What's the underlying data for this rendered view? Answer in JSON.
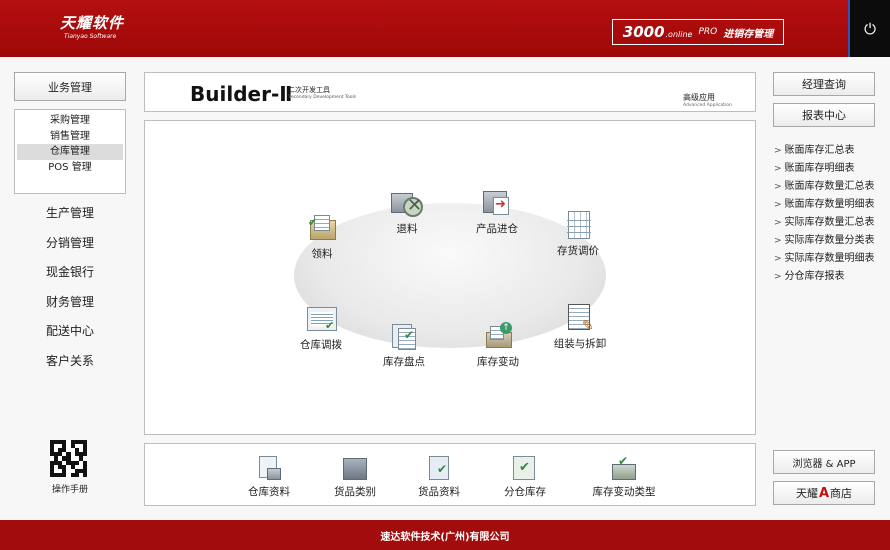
{
  "header": {
    "logo_cn": "天耀软件",
    "logo_en": "Tianyao Software",
    "product_num": "3000",
    "product_online": ".online",
    "product_pro": "PRO",
    "product_title": "进销存管理",
    "power_icon": "power-icon"
  },
  "left_nav": {
    "main_button": "业务管理",
    "submenu": [
      "采购管理",
      "销售管理",
      "仓库管理",
      "POS 管理"
    ],
    "active_submenu": "仓库管理",
    "links": [
      "生产管理",
      "分销管理",
      "现金银行",
      "财务管理",
      "配送中心",
      "客户关系"
    ],
    "qr_caption": "操作手册"
  },
  "banner": {
    "brand": "Builder-Ⅱ",
    "brand_sub_cn": "二次开发工具",
    "brand_sub_en": "Secondary Development Tools",
    "adv_cn": "高级应用",
    "adv_en": "Advanced Application"
  },
  "flow": {
    "items": [
      {
        "label": "退料",
        "icon": "return-material-icon"
      },
      {
        "label": "产品进仓",
        "icon": "product-inbound-icon"
      },
      {
        "label": "领料",
        "icon": "material-requisition-icon"
      },
      {
        "label": "存货调价",
        "icon": "inventory-price-adjust-icon"
      },
      {
        "label": "仓库调拨",
        "icon": "warehouse-transfer-icon"
      },
      {
        "label": "组装与拆卸",
        "icon": "assembly-icon"
      },
      {
        "label": "库存盘点",
        "icon": "stocktake-icon"
      },
      {
        "label": "库存变动",
        "icon": "stock-change-icon"
      }
    ]
  },
  "toolbar": {
    "items": [
      {
        "label": "仓库资料",
        "icon": "warehouse-data-icon"
      },
      {
        "label": "货品类别",
        "icon": "goods-category-icon"
      },
      {
        "label": "货品资料",
        "icon": "goods-data-icon"
      },
      {
        "label": "分仓库存",
        "icon": "branch-stock-icon"
      },
      {
        "label": "库存变动类型",
        "icon": "stock-change-type-icon"
      }
    ]
  },
  "right": {
    "btn_manager_query": "经理查询",
    "btn_report_center": "报表中心",
    "reports": [
      "账面库存汇总表",
      "账面库存明细表",
      "账面库存数量汇总表",
      "账面库存数量明细表",
      "实际库存数量汇总表",
      "实际库存数量分类表",
      "实际库存数量明细表",
      "分仓库存报表"
    ],
    "btn_browser": "浏览器 & APP",
    "btn_shop_pre": "天耀",
    "btn_shop_a": "A",
    "btn_shop_post": "商店"
  },
  "footer": {
    "company": "速达软件技术(广州)有限公司"
  },
  "colors": {
    "header_red": "#b50f0f",
    "footer_red": "#a20c0c",
    "power_bg": "#0c0c0c"
  }
}
